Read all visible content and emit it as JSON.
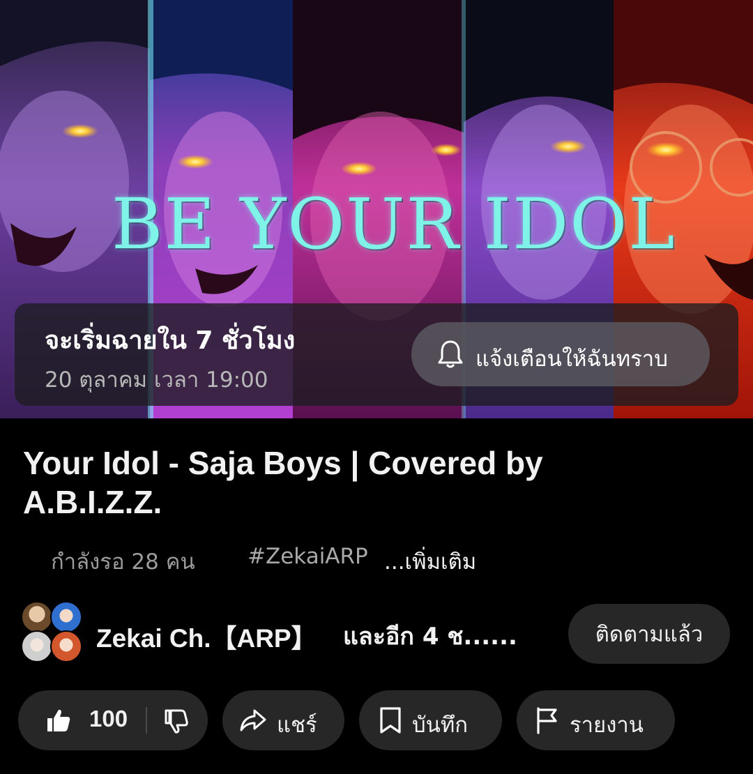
{
  "thumbnail": {
    "art_text": "BE YOUR IDOL"
  },
  "premiere": {
    "title": "จะเริ่มฉายใน 7 ชั่วโมง",
    "datetime": "20 ตุลาคม เวลา 19:00",
    "remind_label": "แจ้งเตือนให้ฉันทราบ"
  },
  "video": {
    "title": "Your Idol - Saja Boys | Covered by A.B.I.Z.Z.",
    "waiting": "กำลังรอ 28 คน",
    "hashtag": "#ZekaiARP",
    "more_label": "...เพิ่มเติม"
  },
  "channel": {
    "name": "Zekai Ch.【ARP】",
    "collab_text": "และอีก 4 ช......",
    "subscribe_label": "ติดตามแล้ว"
  },
  "actions": {
    "like_count": "100",
    "share_label": "แชร์",
    "save_label": "บันทึก",
    "report_label": "รายงาน"
  },
  "icons": [
    "bell-icon",
    "thumb-up-icon",
    "thumb-down-icon",
    "share-arrow-icon",
    "bookmark-icon",
    "flag-icon"
  ]
}
